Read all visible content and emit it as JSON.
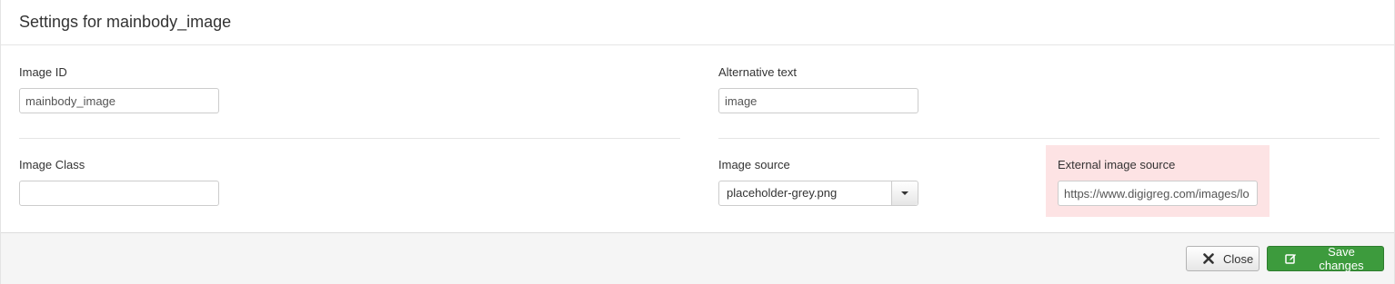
{
  "header": {
    "title": "Settings for mainbody_image"
  },
  "form": {
    "image_id": {
      "label": "Image ID",
      "value": "mainbody_image"
    },
    "alt_text": {
      "label": "Alternative text",
      "value": "image"
    },
    "image_class": {
      "label": "Image Class",
      "value": ""
    },
    "image_source": {
      "label": "Image source",
      "selected": "placeholder-grey.png"
    },
    "external_source": {
      "label": "External image source",
      "value": "https://www.digigreg.com/images/lo"
    }
  },
  "footer": {
    "close_label": "Close",
    "save_label": "Save changes"
  },
  "icons": {
    "close": "x-icon",
    "save": "edit-icon",
    "dropdown": "caret-down-icon"
  },
  "colors": {
    "save_button": "#3d9b3d",
    "highlight_bg": "#fde3e4",
    "footer_bg": "#f5f5f5"
  }
}
